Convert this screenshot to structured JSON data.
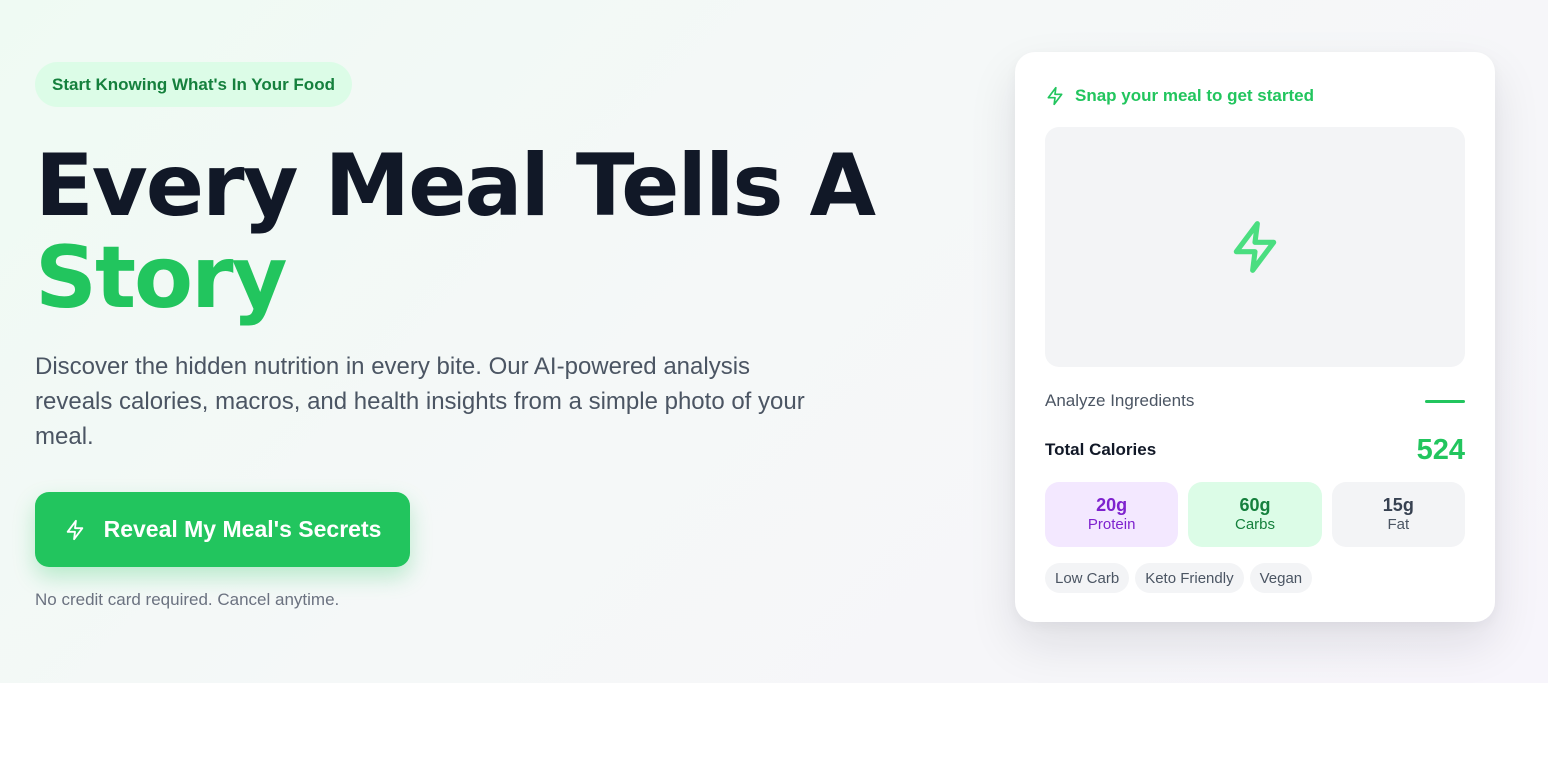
{
  "hero": {
    "badge": "Start Knowing What's In Your Food",
    "headline_line1": "Every Meal Tells A",
    "headline_line2": "Story",
    "subtext": "Discover the hidden nutrition in every bite. Our AI-powered analysis reveals calories, macros, and health insights from a simple photo of your meal.",
    "cta_label": "Reveal My Meal's Secrets",
    "cta_icon": "lightning-icon",
    "footnote": "No credit card required. Cancel anytime."
  },
  "card": {
    "header_icon": "lightning-icon",
    "header_text": "Snap your meal to get started",
    "placeholder_icon": "lightning-icon",
    "analyze_label": "Analyze Ingredients",
    "total_label": "Total Calories",
    "total_value": "524",
    "macros": [
      {
        "value": "20g",
        "label": "Protein"
      },
      {
        "value": "60g",
        "label": "Carbs"
      },
      {
        "value": "15g",
        "label": "Fat"
      }
    ],
    "tags": [
      "Low Carb",
      "Keto Friendly",
      "Vegan"
    ]
  },
  "colors": {
    "accent": "#22c55e",
    "badge_bg": "#dcfce7",
    "badge_text": "#15803d",
    "heading": "#111827",
    "protein_bg": "#f3e8ff",
    "protein_text": "#7e22ce",
    "placeholder_bg": "#f3f4f6"
  }
}
